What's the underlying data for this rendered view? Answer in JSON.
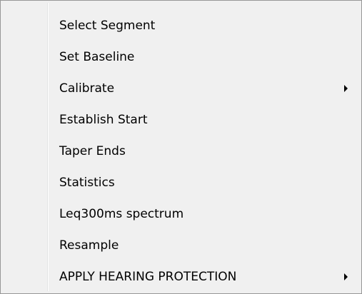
{
  "context_menu": {
    "items": [
      {
        "label": "Select Segment",
        "has_submenu": false
      },
      {
        "label": "Set Baseline",
        "has_submenu": false
      },
      {
        "label": "Calibrate",
        "has_submenu": true
      },
      {
        "label": "Establish Start",
        "has_submenu": false
      },
      {
        "label": "Taper Ends",
        "has_submenu": false
      },
      {
        "label": "Statistics",
        "has_submenu": false
      },
      {
        "label": "Leq300ms spectrum",
        "has_submenu": false
      },
      {
        "label": "Resample",
        "has_submenu": false
      },
      {
        "label": "APPLY HEARING PROTECTION",
        "has_submenu": true
      }
    ]
  }
}
